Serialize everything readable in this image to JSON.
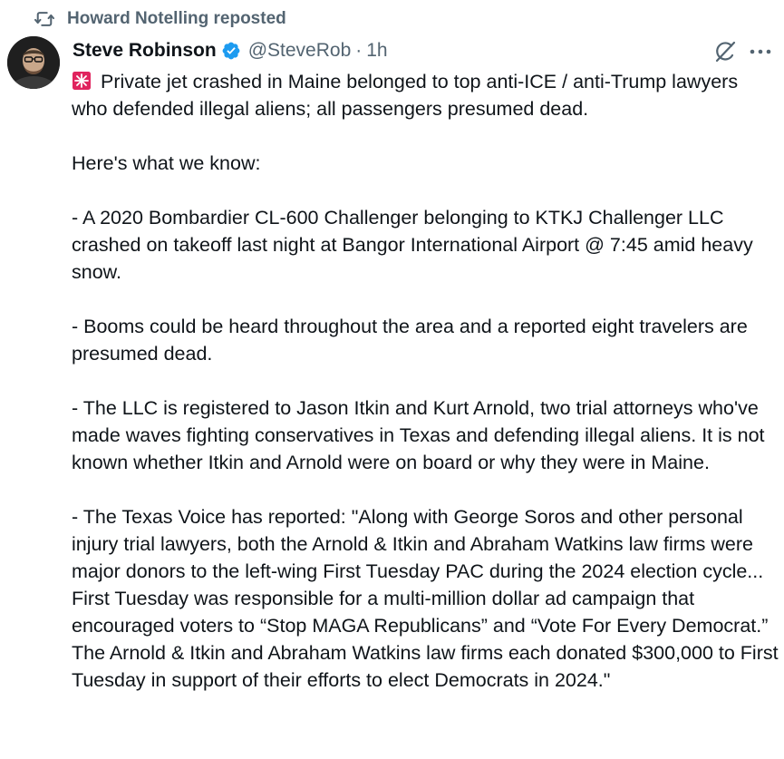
{
  "repost": {
    "icon": "repost-icon",
    "text": "Howard Notelling reposted"
  },
  "author": {
    "name": "Steve Robinson",
    "handle": "@SteveRob",
    "separator": "·",
    "time": "1h",
    "verified_icon": "verified-badge-icon",
    "verified_color": "#1d9bf0"
  },
  "actions": {
    "grok_icon": "grok-icon",
    "more_icon": "more-icon"
  },
  "tweet": {
    "lead_emoji": "rotating-light-emoji",
    "headline": "Private jet crashed in Maine belonged to top anti-ICE / anti-Trump lawyers who defended illegal aliens; all passengers presumed dead.",
    "paragraphs": [
      "Here's what we know:",
      "- A 2020 Bombardier CL-600 Challenger belonging to KTKJ Challenger LLC crashed on takeoff last night at Bangor International Airport @ 7:45 amid heavy snow.",
      "- Booms could be heard throughout the area and a reported eight travelers are presumed dead.",
      "- The LLC is registered to Jason Itkin and Kurt Arnold, two trial attorneys who've made waves fighting conservatives in Texas and defending illegal aliens. It is not known whether Itkin and Arnold were on board or why they were in Maine.",
      "- The Texas Voice has reported: \"Along with George Soros and other personal injury trial lawyers, both the Arnold & Itkin and Abraham Watkins law firms were major donors to the left-wing First Tuesday PAC during the 2024 election cycle... First Tuesday was responsible for a multi-million dollar ad campaign that encouraged voters to “Stop MAGA Republicans” and “Vote For Every Democrat.” The Arnold & Itkin and Abraham Watkins law firms each donated $300,000 to First Tuesday in support of their efforts to elect Democrats in 2024.\""
    ]
  }
}
